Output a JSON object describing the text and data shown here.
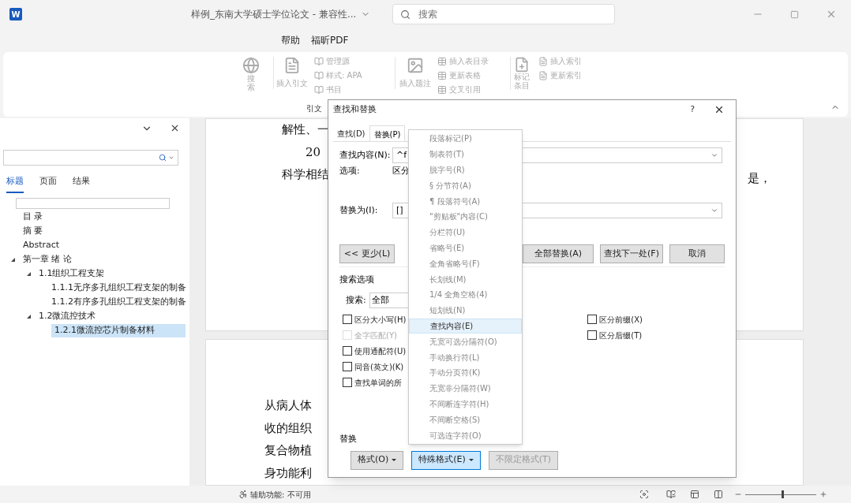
{
  "title_bar": {
    "app_icon": "W",
    "document_title": "样例_东南大学硕士学位论文 - 兼容性...",
    "search_placeholder": "搜索"
  },
  "ribbon_tabs": [
    {
      "label": "帮助",
      "selected": false
    },
    {
      "label": "福昕PDF",
      "selected": false
    }
  ],
  "ribbon": {
    "search_button": "搜索",
    "insert_citation": "插入引文",
    "citation_items": [
      "管理源",
      "样式: APA",
      "书目"
    ],
    "insert_caption": "插入题注",
    "caption_items": [
      "插入表目录",
      "更新表格",
      "交叉引用"
    ],
    "mark_entry": "标记条目",
    "index_items": [
      "插入索引",
      "更新索引"
    ],
    "group_label": "引文"
  },
  "nav_pane": {
    "tabs": [
      {
        "label": "标题",
        "selected": true
      },
      {
        "label": "页面",
        "selected": false
      },
      {
        "label": "结果",
        "selected": false
      }
    ],
    "headings": [
      {
        "text": "目 录",
        "selected": false
      },
      {
        "text": "摘 要",
        "selected": false
      },
      {
        "text": "Abstract",
        "selected": false
      },
      {
        "text": "第一章 绪 论",
        "selected": false,
        "expanded": true,
        "children": [
          {
            "text": "1.1组织工程支架",
            "selected": false,
            "expanded": true,
            "children": [
              {
                "text": "1.1.1无序多孔组织工程支架的制备",
                "selected": false
              },
              {
                "text": "1.1.2有序多孔组织工程支架的制备",
                "selected": false
              }
            ]
          },
          {
            "text": "1.2微流控技术",
            "selected": false,
            "expanded": true,
            "children": [
              {
                "text": "1.2.1微流控芯片制备材料",
                "selected": true
              }
            ]
          }
        ]
      }
    ]
  },
  "document": {
    "page_1_lines": [
      "解性、一",
      "20",
      "科学相结"
    ],
    "page_1_right": "是，",
    "page_2_lines": [
      "从病人体",
      "收的组织",
      "复合物植",
      "身功能利"
    ]
  },
  "dialog": {
    "title": "查找和替换",
    "help": "?",
    "tabs": [
      {
        "label": "查找(D)",
        "selected": false
      },
      {
        "label": "替换(P)",
        "selected": true
      }
    ],
    "find_label": "查找内容(N):",
    "find_value": "^f",
    "options_label": "选项:",
    "options_value": "区分",
    "replace_label": "替换为(I):",
    "replace_value": "[]",
    "less_button": "<< 更少(L)",
    "replace_all_button": "全部替换(A)",
    "find_next_button": "查找下一处(F)",
    "cancel_button": "取消",
    "search_options_label": "搜索选项",
    "search_label": "搜索:",
    "search_value": "全部",
    "left_checkboxes": [
      {
        "label": "区分大小写(H)",
        "checked": false,
        "disabled": false
      },
      {
        "label": "全字匹配(Y)",
        "checked": false,
        "disabled": true
      },
      {
        "label": "使用通配符(U)",
        "checked": false,
        "disabled": false
      },
      {
        "label": "同音(英文)(K)",
        "checked": false,
        "disabled": false
      },
      {
        "label": "查找单词的所",
        "checked": false,
        "disabled": false
      }
    ],
    "right_checkboxes": [
      {
        "label": "区分前缀(X)",
        "checked": false,
        "disabled": false
      },
      {
        "label": "区分后缀(T)",
        "checked": false,
        "disabled": false
      }
    ],
    "replace_section_label": "替换",
    "bottom_buttons": [
      {
        "label": "格式(O)",
        "has_menu": true,
        "pressed": false,
        "disabled": false
      },
      {
        "label": "特殊格式(E)",
        "has_menu": true,
        "pressed": true,
        "disabled": false
      },
      {
        "label": "不限定格式(T)",
        "has_menu": false,
        "pressed": false,
        "disabled": true
      }
    ]
  },
  "special_menu": [
    {
      "label": "段落标记(P)",
      "selected": false
    },
    {
      "label": "制表符(T)",
      "selected": false
    },
    {
      "label": "脱字号(R)",
      "selected": false
    },
    {
      "label": "§ 分节符(A)",
      "selected": false
    },
    {
      "label": "¶ 段落符号(A)",
      "selected": false
    },
    {
      "label": "\"剪贴板\"内容(C)",
      "selected": false
    },
    {
      "label": "分栏符(U)",
      "selected": false
    },
    {
      "label": "省略号(E)",
      "selected": false
    },
    {
      "label": "全角省略号(F)",
      "selected": false
    },
    {
      "label": "长划线(M)",
      "selected": false
    },
    {
      "label": "1/4 全角空格(4)",
      "selected": false
    },
    {
      "label": "短划线(N)",
      "selected": false
    },
    {
      "label": "查找内容(E)",
      "selected": true
    },
    {
      "label": "无宽可选分隔符(O)",
      "selected": false
    },
    {
      "label": "手动换行符(L)",
      "selected": false
    },
    {
      "label": "手动分页符(K)",
      "selected": false
    },
    {
      "label": "无宽非分隔符(W)",
      "selected": false
    },
    {
      "label": "不间断连字符(H)",
      "selected": false
    },
    {
      "label": "不间断空格(S)",
      "selected": false
    },
    {
      "label": "可选连字符(O)",
      "selected": false
    }
  ],
  "status_bar": {
    "accessibility": "辅助功能: 不可用",
    "zoom": {
      "level": 0.53
    }
  }
}
